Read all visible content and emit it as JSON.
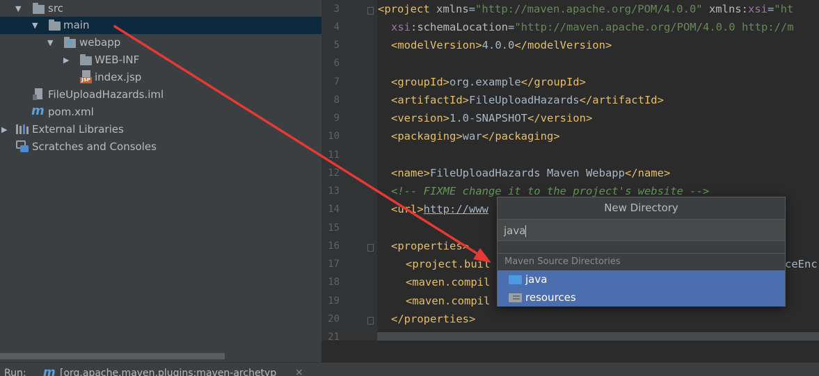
{
  "tree": {
    "items": [
      {
        "label": "src",
        "icon": "folder-icon"
      },
      {
        "label": "main",
        "icon": "folder-icon"
      },
      {
        "label": "webapp",
        "icon": "web-folder-icon"
      },
      {
        "label": "WEB-INF",
        "icon": "folder-icon"
      },
      {
        "label": "index.jsp",
        "icon": "jsp-file-icon",
        "badge": "JSP"
      },
      {
        "label": "FileUploadHazards.iml",
        "icon": "iml-file-icon"
      },
      {
        "label": "pom.xml",
        "icon": "maven-file-icon",
        "badge": "m"
      },
      {
        "label": "External Libraries",
        "icon": "libraries-icon"
      },
      {
        "label": "Scratches and Consoles",
        "icon": "scratches-icon"
      }
    ]
  },
  "editor": {
    "line_numbers": [
      "3",
      "4",
      "5",
      "6",
      "7",
      "8",
      "9",
      "10",
      "11",
      "12",
      "13",
      "14",
      "15",
      "16",
      "17",
      "18",
      "19",
      "20",
      "21"
    ],
    "lines": {
      "l3_open": "<project ",
      "l3_attr1": "xmlns",
      "l3_eq1": "=",
      "l3_val1": "\"http://maven.apache.org/POM/4.0.0\"",
      "l3_attr2": " xmlns",
      "l3_colon": ":",
      "l3_ns": "xsi",
      "l3_eq2": "=",
      "l3_val2": "\"ht",
      "l4_ns": "xsi",
      "l4_colon": ":",
      "l4_attr": "schemaLocation",
      "l4_eq": "=",
      "l4_val": "\"http://maven.apache.org/POM/4.0.0 http://m",
      "l5_open": "<modelVersion>",
      "l5_text": "4.0.0",
      "l5_close": "</modelVersion>",
      "l7_open": "<groupId>",
      "l7_text": "org.example",
      "l7_close": "</groupId>",
      "l8_open": "<artifactId>",
      "l8_text": "FileUploadHazards",
      "l8_close": "</artifactId>",
      "l9_open": "<version>",
      "l9_text": "1.0-SNAPSHOT",
      "l9_close": "</version>",
      "l10_open": "<packaging>",
      "l10_text": "war",
      "l10_close": "</packaging>",
      "l12_open": "<name>",
      "l12_text": "FileUploadHazards Maven Webapp",
      "l12_close": "</name>",
      "l13_comment": "<!-- FIXME change it to the project's website -->",
      "l14_open": "<url>",
      "l14_text": "http://www",
      "l16_open": "<properties>",
      "l17_open": "<project.buil",
      "l17_right": "ceEnc",
      "l18_open": "<maven.compil",
      "l19_open": "<maven.compil",
      "l20_close": "</properties>"
    }
  },
  "popup": {
    "title": "New Directory",
    "input_value": "java",
    "group_label": "Maven Source Directories",
    "options": [
      {
        "label": "java",
        "icon": "source-folder-icon"
      },
      {
        "label": "resources",
        "icon": "resources-folder-icon"
      }
    ]
  },
  "runbar": {
    "label": "Run:",
    "tab_label": "[org.apache.maven.plugins:maven-archetyp",
    "close_glyph": "×"
  },
  "colors": {
    "selection": "#0d293e",
    "popup_highlight": "#4b6eaf",
    "annotation_arrow": "#e53935"
  }
}
